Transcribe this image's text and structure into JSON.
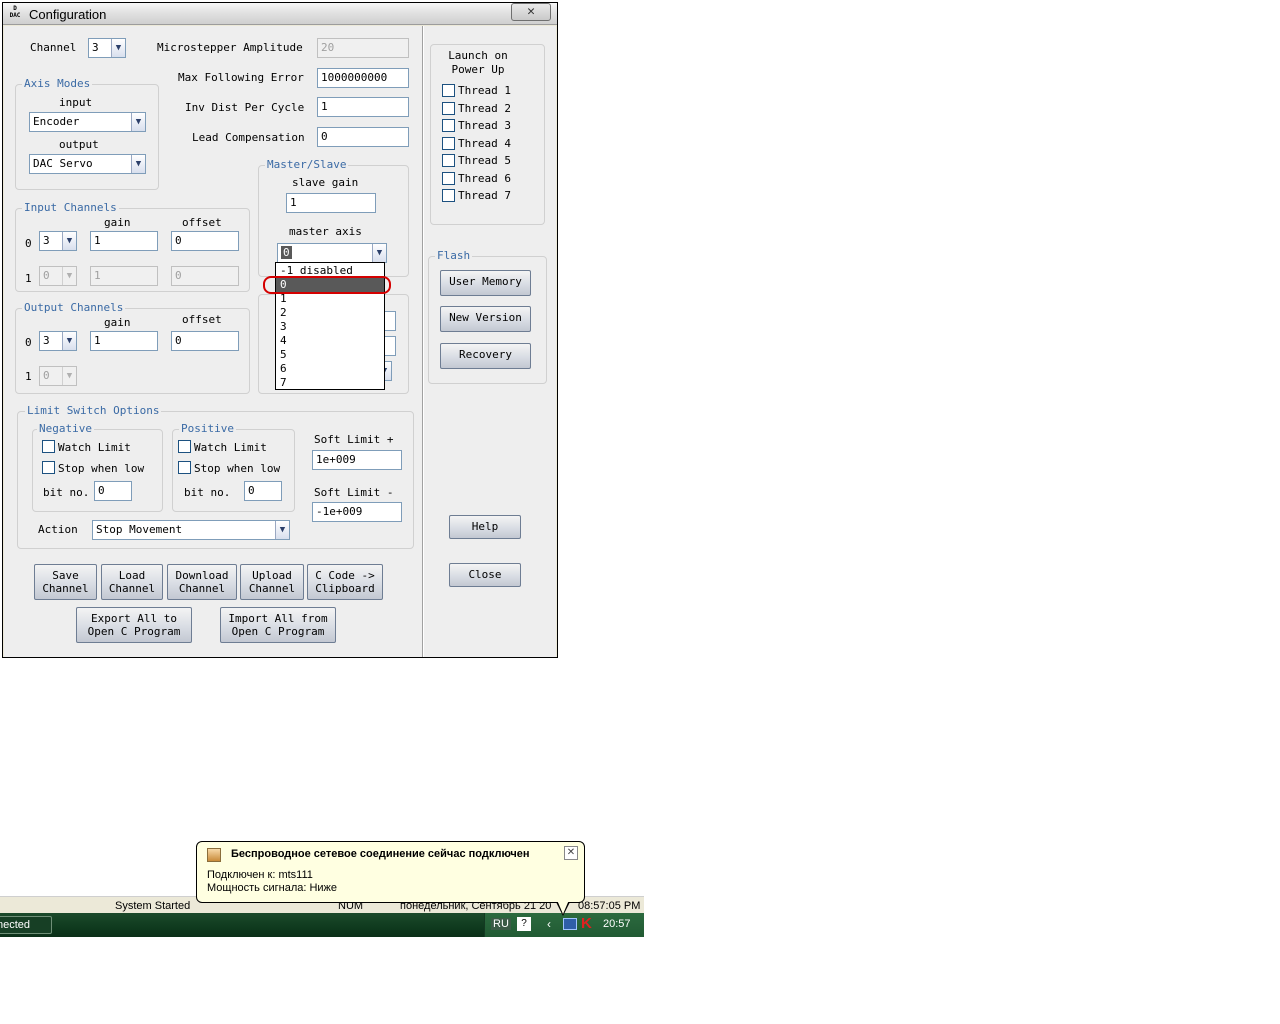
{
  "window": {
    "title": "Configuration",
    "icon_text": "D\nDAC",
    "close_glyph": "✕"
  },
  "channel": {
    "label": "Channel",
    "value": "3"
  },
  "right_fields": [
    {
      "label": "Microstepper Amplitude",
      "value": "20",
      "disabled": true
    },
    {
      "label": "Max Following Error",
      "value": "1000000000"
    },
    {
      "label": "Inv Dist Per Cycle",
      "value": "1"
    },
    {
      "label": "Lead Compensation",
      "value": "0"
    }
  ],
  "axis_modes": {
    "title": "Axis Modes",
    "input_label": "input",
    "input_value": "Encoder",
    "output_label": "output",
    "output_value": "DAC Servo"
  },
  "input_channels": {
    "title": "Input Channels",
    "gain_label": "gain",
    "offset_label": "offset",
    "rows": [
      {
        "index": "0",
        "channel": "3",
        "gain": "1",
        "offset": "0"
      },
      {
        "index": "1",
        "channel": "0",
        "gain": "1",
        "offset": "0"
      }
    ]
  },
  "output_channels": {
    "title": "Output Channels",
    "gain_label": "gain",
    "offset_label": "offset",
    "rows": [
      {
        "index": "0",
        "channel": "3",
        "gain": "1",
        "offset": "0"
      },
      {
        "index": "1",
        "channel": "0"
      }
    ]
  },
  "master_slave": {
    "title": "Master/Slave",
    "slave_gain_label": "slave gain",
    "slave_gain_value": "1",
    "master_axis_label": "master axis",
    "master_axis_value": "0"
  },
  "dropdown_options": [
    "-1 disabled",
    "0",
    "1",
    "2",
    "3",
    "4",
    "5",
    "6",
    "7"
  ],
  "dropdown_selected": "0",
  "launch": {
    "title": "Launch on\nPower Up",
    "threads": [
      "Thread 1",
      "Thread 2",
      "Thread 3",
      "Thread 4",
      "Thread 5",
      "Thread 6",
      "Thread 7"
    ]
  },
  "flash": {
    "title": "Flash",
    "buttons": [
      "User Memory",
      "New Version",
      "Recovery"
    ]
  },
  "limit_switch": {
    "title": "Limit Switch Options",
    "negative": {
      "title": "Negative",
      "watch": "Watch Limit",
      "stop": "Stop when low",
      "bit_label": "bit no.",
      "bit_value": "0"
    },
    "positive": {
      "title": "Positive",
      "watch": "Watch Limit",
      "stop": "Stop when low",
      "bit_label": "bit no.",
      "bit_value": "0"
    },
    "soft_plus_label": "Soft Limit +",
    "soft_plus_value": "1e+009",
    "soft_minus_label": "Soft Limit -",
    "soft_minus_value": "-1e+009",
    "action_label": "Action",
    "action_value": "Stop Movement"
  },
  "bottom_buttons": [
    "Save\nChannel",
    "Load\nChannel",
    "Download\nChannel",
    "Upload\nChannel",
    "C Code ->\nClipboard"
  ],
  "export_buttons": [
    "Export All to\nOpen C Program",
    "Import All from\nOpen C Program"
  ],
  "side_buttons": {
    "help": "Help",
    "close": "Close"
  },
  "statusbar": {
    "left": "System Started",
    "num": "NUM",
    "date": "понедельник, Сентябрь 21 20",
    "time": "08:57:05 PM"
  },
  "taskbar": {
    "task": "nected",
    "lang": "RU",
    "clock": "20:57"
  },
  "balloon": {
    "title": "Беспроводное сетевое соединение сейчас подключен",
    "line1": "Подключен к: mts111",
    "line2": "Мощность сигнала: Ниже"
  },
  "colors": {
    "accent": "#3a6aa5",
    "selected": "#595959",
    "highlight_ring": "#d40000",
    "taskbar": "#0f3a1e"
  }
}
